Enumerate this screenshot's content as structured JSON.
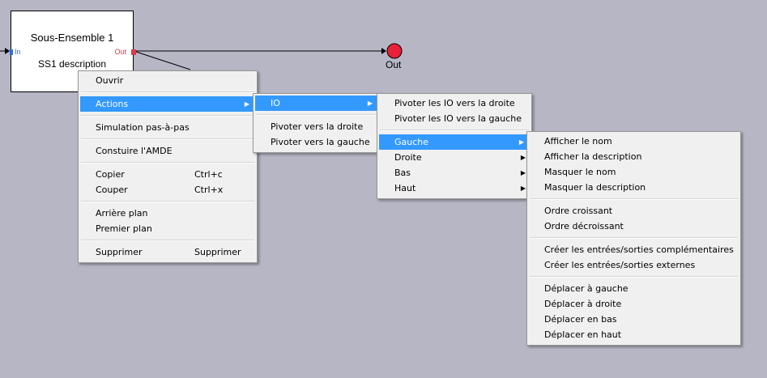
{
  "block": {
    "title": "Sous-Ensemble 1",
    "description": "SS1 description",
    "in_label": "In",
    "out_label": "Out"
  },
  "output_node": {
    "label": "Out",
    "color": "#e8203a"
  },
  "context_menu": {
    "ouvrir": "Ouvrir",
    "actions": "Actions",
    "simulation": "Simulation pas-à-pas",
    "construire": "Constuire l'AMDE",
    "copier": "Copier",
    "copier_shortcut": "Ctrl+c",
    "couper": "Couper",
    "couper_shortcut": "Ctrl+x",
    "arriere": "Arrière plan",
    "premier": "Premier plan",
    "supprimer": "Supprimer",
    "supprimer_shortcut": "Supprimer"
  },
  "actions_menu": {
    "io": "IO",
    "pivoter_droite": "Pivoter vers la droite",
    "pivoter_gauche": "Pivoter vers la gauche"
  },
  "io_menu": {
    "pivoter_io_droite": "Pivoter les IO vers la droite",
    "pivoter_io_gauche": "Pivoter les IO vers la gauche",
    "gauche": "Gauche",
    "droite": "Droite",
    "bas": "Bas",
    "haut": "Haut"
  },
  "gauche_menu": {
    "afficher_nom": "Afficher le nom",
    "afficher_description": "Afficher la description",
    "masquer_nom": "Masquer le nom",
    "masquer_description": "Masquer la description",
    "ordre_croissant": "Ordre croissant",
    "ordre_decroissant": "Ordre décroissant",
    "creer_complementaires": "Créer les entrées/sorties complémentaires",
    "creer_externes": "Créer les entrées/sorties externes",
    "deplacer_gauche": "Déplacer à gauche",
    "deplacer_droite": "Déplacer à droite",
    "deplacer_bas": "Déplacer en bas",
    "deplacer_haut": "Déplacer en haut"
  },
  "colors": {
    "canvas": "#b6b6c5",
    "menu_bg": "#f0f0f0",
    "highlight": "#3399ff",
    "in_port": "#2f6fe0",
    "out_port": "#d83a4a"
  }
}
